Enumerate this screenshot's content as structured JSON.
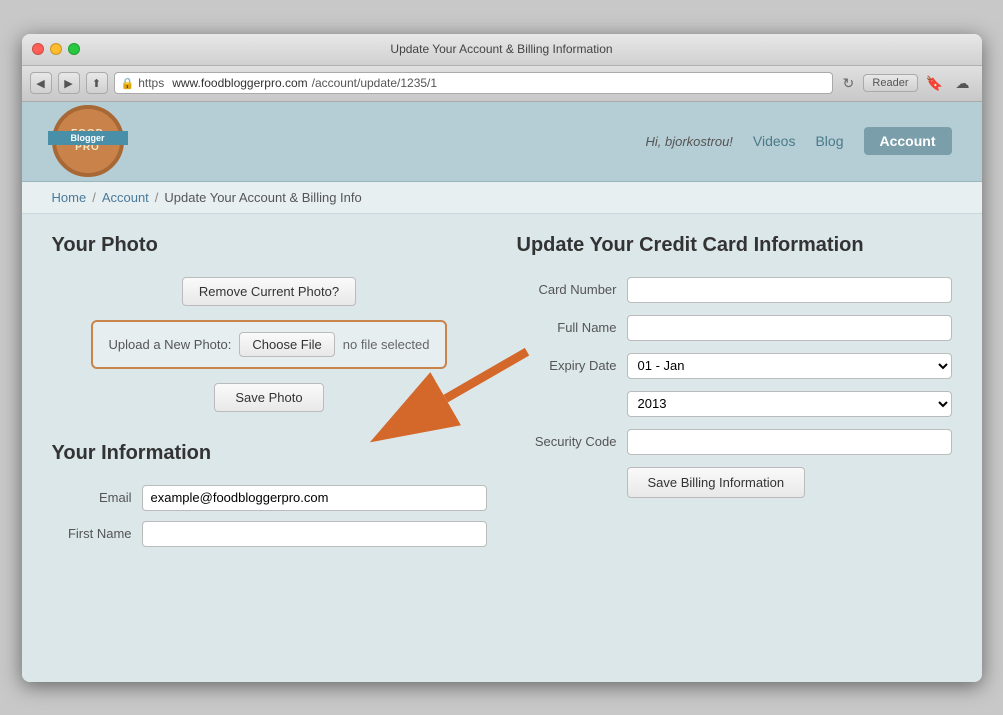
{
  "window": {
    "title": "Update Your Account & Billing Information",
    "url_protocol": "https",
    "url_domain": "www.foodbloggerpro.com",
    "url_path": "/account/update/1235/1",
    "reader_label": "Reader"
  },
  "header": {
    "greeting": "Hi, bjorkostrou!",
    "nav_videos": "Videos",
    "nav_blog": "Blog",
    "nav_account": "Account"
  },
  "breadcrumb": {
    "home": "Home",
    "account": "Account",
    "current": "Update Your Account & Billing Info"
  },
  "photo_section": {
    "title": "Your Photo",
    "remove_btn": "Remove Current Photo?",
    "upload_label": "Upload a New Photo:",
    "choose_file_btn": "Choose File",
    "no_file_text": "no file selected",
    "save_photo_btn": "Save Photo"
  },
  "info_section": {
    "title": "Your Information",
    "email_label": "Email",
    "email_value": "example@foodbloggerpro.com",
    "first_name_label": "First Name",
    "first_name_value": ""
  },
  "cc_section": {
    "title": "Update Your Credit Card Information",
    "card_number_label": "Card Number",
    "card_number_value": "",
    "full_name_label": "Full Name",
    "full_name_value": "",
    "expiry_label": "Expiry Date",
    "expiry_month": "01 - Jan",
    "expiry_year": "2013",
    "security_code_label": "Security Code",
    "security_code_value": "",
    "save_billing_btn": "Save Billing Information"
  },
  "logo": {
    "food": "FOOD",
    "blogger": "Blogger",
    "pro": "PRO"
  }
}
